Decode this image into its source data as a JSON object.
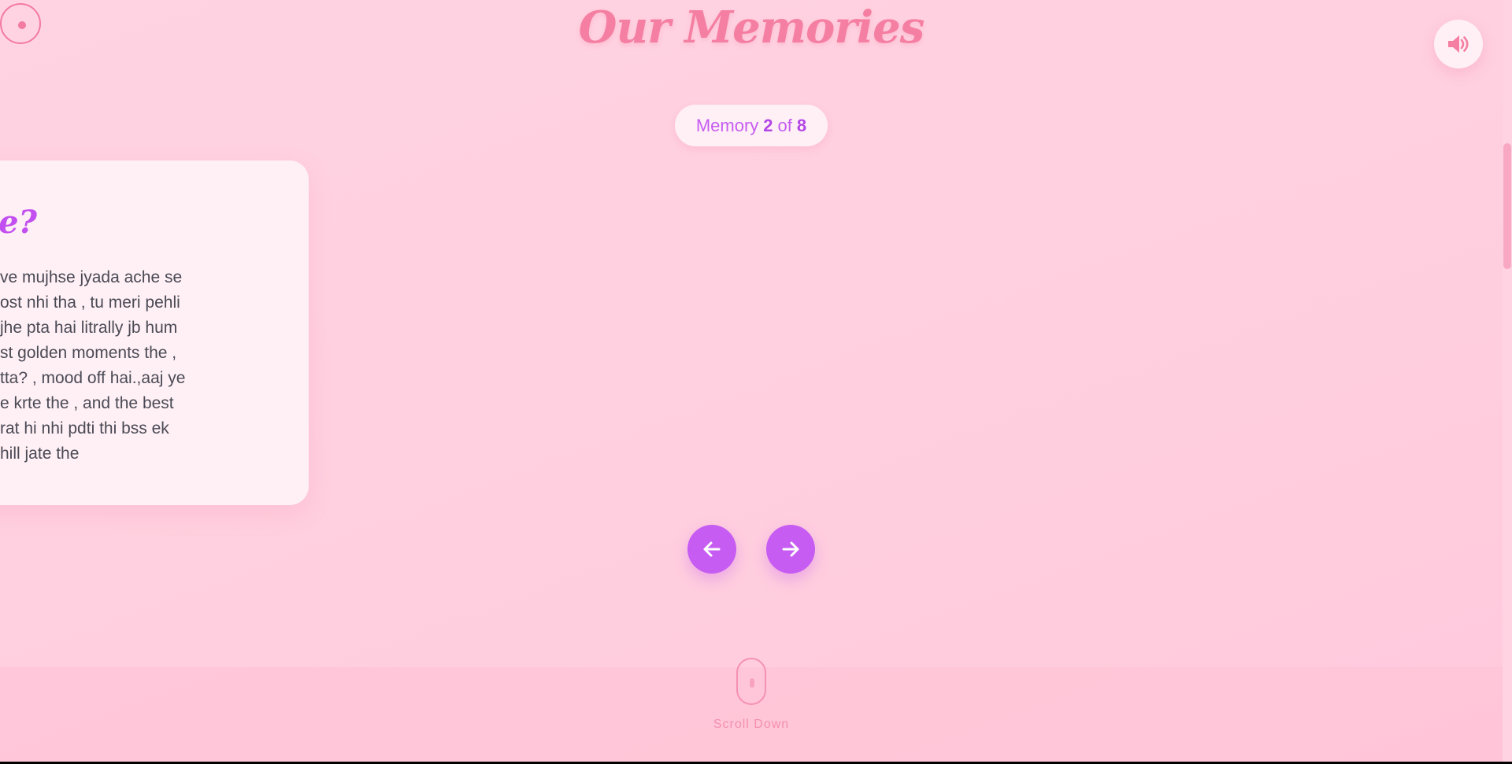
{
  "header": {
    "title": "Our Memories",
    "sound_icon": "speaker-volume-icon"
  },
  "counter": {
    "prefix": "Memory",
    "current": "2",
    "separator": "of",
    "total": "8"
  },
  "card": {
    "title_visible": "me?",
    "lines": [
      "ve mujhse jyada ache se",
      "ost nhi tha , tu meri pehli",
      "jhe pta hai litrally jb hum",
      "st golden moments the ,",
      "tta? , mood off hai.,aaj ye",
      "e krte the , and the best",
      "rat hi nhi pdti thi bss ek",
      "hill jate the"
    ]
  },
  "navigation": {
    "prev_icon": "arrow-left-icon",
    "next_icon": "arrow-right-icon"
  },
  "scroll_hint": {
    "label": "Scroll Down",
    "icon": "mouse-icon"
  },
  "colors": {
    "background": "#ffd3e2",
    "title": "#f57fa2",
    "accent": "#c65cf2",
    "card": "#fff0f5",
    "text": "#4a4a55"
  }
}
